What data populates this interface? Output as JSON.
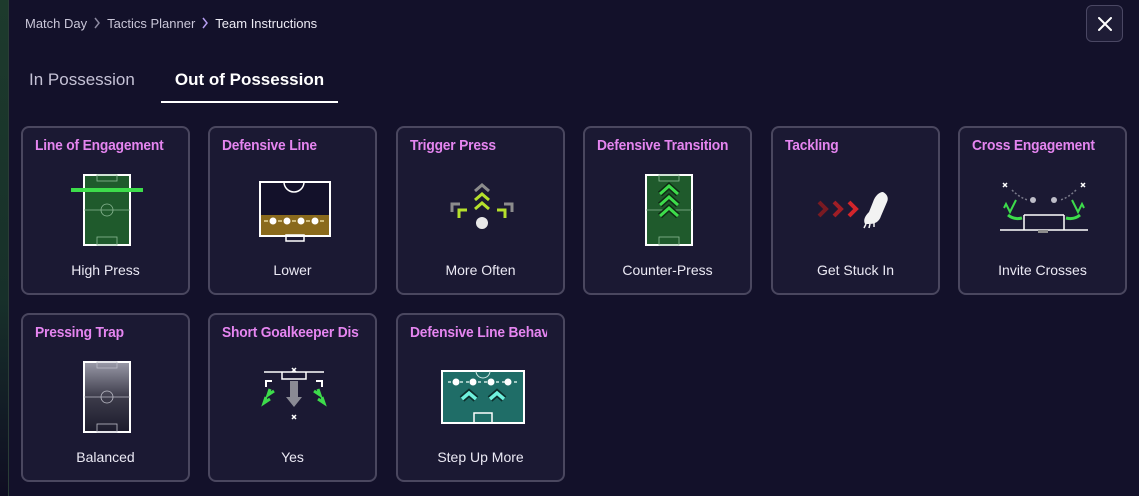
{
  "breadcrumb": {
    "items": [
      "Match Day",
      "Tactics Planner",
      "Team Instructions"
    ]
  },
  "tabs": [
    {
      "label": "In Possession",
      "active": false
    },
    {
      "label": "Out of Possession",
      "active": true
    }
  ],
  "cards": [
    {
      "title": "Line of Engagement",
      "value": "High Press",
      "icon": "pitch-high-line-icon"
    },
    {
      "title": "Defensive Line",
      "value": "Lower",
      "icon": "low-defensive-line-icon"
    },
    {
      "title": "Trigger Press",
      "value": "More Often",
      "icon": "trigger-press-arrows-icon"
    },
    {
      "title": "Defensive Transition",
      "value": "Counter-Press",
      "icon": "counter-press-pitch-icon"
    },
    {
      "title": "Tackling",
      "value": "Get Stuck In",
      "icon": "boot-tackle-icon"
    },
    {
      "title": "Cross Engagement",
      "value": "Invite Crosses",
      "icon": "invite-crosses-icon"
    },
    {
      "title": "Pressing Trap",
      "value": "Balanced",
      "icon": "pressing-trap-pitch-icon"
    },
    {
      "title": "Short Goalkeeper Distr",
      "value": "Yes",
      "icon": "goalkeeper-distribution-icon"
    },
    {
      "title": "Defensive Line Behavio",
      "value": "Step Up More",
      "icon": "step-up-line-icon"
    }
  ],
  "colors": {
    "accent_title": "#e585f0",
    "pitch_green": "#1f5a2c",
    "highlight_green": "#3ddc4b",
    "lime": "#b6e02c",
    "red": "#d3252b",
    "teal": "#1f6d67"
  },
  "icons": {
    "close": "close-icon",
    "separator": "chevron-right-icon"
  }
}
